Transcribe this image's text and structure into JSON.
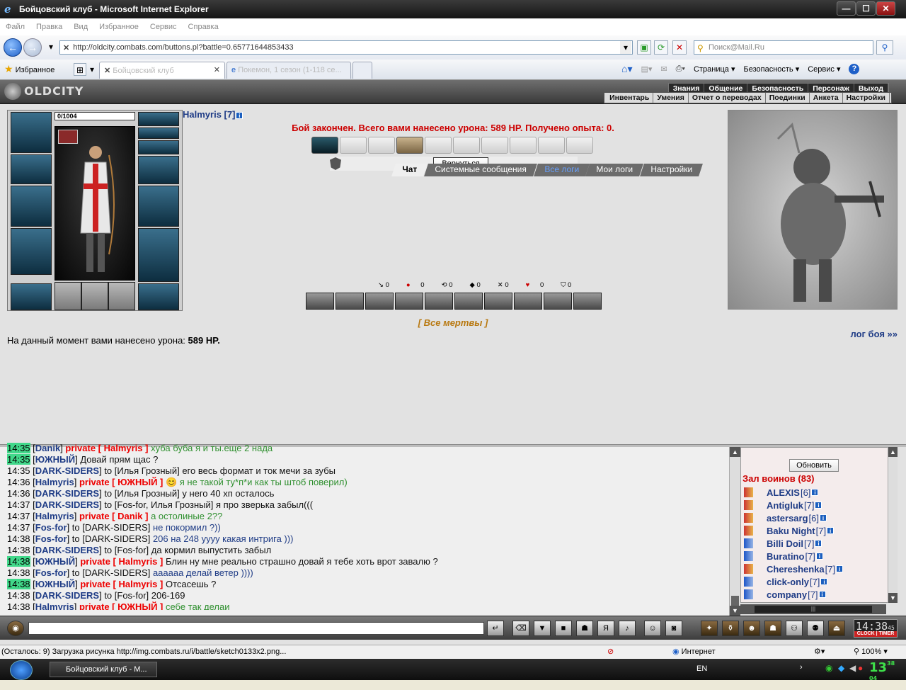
{
  "window": {
    "title": "Бойцовский клуб - Microsoft Internet Explorer",
    "minimize": "—",
    "maximize": "☐",
    "close": "✕"
  },
  "menu": [
    "Файл",
    "Правка",
    "Вид",
    "Избранное",
    "Сервис",
    "Справка"
  ],
  "address": {
    "url": "http://oldcity.combats.com/buttons.pl?battle=0.65771644853433",
    "search_placeholder": "Поиск@Mail.Ru"
  },
  "favorites": {
    "label": "Избранное",
    "tabs": [
      "Бойцовский клуб",
      "Покемон, 1 сезон (1-118 се..."
    ]
  },
  "command_bar": [
    "Страница ▾",
    "Безопасность ▾",
    "Сервис ▾"
  ],
  "game": {
    "logo": "OLDCITY",
    "top_nav": [
      "Знания",
      "Общение",
      "Безопасность",
      "Персонаж",
      "Выход"
    ],
    "sub_nav": [
      "Инвентарь",
      "Умения",
      "Отчет о переводах",
      "Поединки",
      "Анкета",
      "Настройки"
    ],
    "character": {
      "hp": "0/1004",
      "name": "Halmyris [7]",
      "info": "i"
    },
    "battle_message": "Бой закончен. Всего вами нанесено урона: 589 HP. Получено опыта: 0.",
    "return_button": "Вернуться",
    "stats": [
      "0",
      "0",
      "0",
      "0",
      "0",
      "0",
      "0"
    ],
    "all_dead": "[ Все мертвы ]",
    "damage_prefix": "На данный момент вами нанесено урона: ",
    "damage_value": "589 HP.",
    "battle_log": "лог боя »»"
  },
  "chat": {
    "tabs": [
      "Чат",
      "Системные сообщения",
      "Все логи",
      "Мои логи",
      "Настройки"
    ],
    "lines": [
      {
        "t": "14:35",
        "hl": true,
        "nick": "Danik",
        "private": "private [ Halmyris ]",
        "to": "",
        "msg": " хуба буба я и ты.еще 2 нада",
        "mc": "g"
      },
      {
        "t": "14:35",
        "hl": true,
        "nick": "ЮЖНЫЙ",
        "private": "",
        "to": "",
        "msg": " Довай прям щас ?",
        "mc": "k"
      },
      {
        "t": "14:35",
        "hl": false,
        "nick": "DARK-SIDERS",
        "private": "",
        "to": "to [Илья Грозный]",
        "msg": " его весь формат и ток мечи за зубы",
        "mc": "k"
      },
      {
        "t": "14:36",
        "hl": false,
        "nick": "Halmyris",
        "private": "private [ ЮЖНЫЙ ]",
        "to": "",
        "msg": " 😊 я не такой ту*п*и как ты штоб поверил)",
        "mc": "g"
      },
      {
        "t": "14:36",
        "hl": false,
        "nick": "DARK-SIDERS",
        "private": "",
        "to": "to [Илья Грозный]",
        "msg": " у него 40 хп осталось",
        "mc": "k"
      },
      {
        "t": "14:37",
        "hl": false,
        "nick": "DARK-SIDERS",
        "private": "",
        "to": "to [Fos-for, Илья Грозный]",
        "msg": " я про зверька забыл(((",
        "mc": "k"
      },
      {
        "t": "14:37",
        "hl": false,
        "nick": "Halmyris",
        "private": "private [ Danik ]",
        "to": "",
        "msg": " а остолиные 2??",
        "mc": "g"
      },
      {
        "t": "14:37",
        "hl": false,
        "nick": "Fos-for",
        "private": "",
        "to": "to [DARK-SIDERS]",
        "msg": " не покормил ?))",
        "mc": "b"
      },
      {
        "t": "14:38",
        "hl": false,
        "nick": "Fos-for",
        "private": "",
        "to": "to [DARK-SIDERS]",
        "msg": " 206 на 248 уууу какая интрига )))",
        "mc": "b"
      },
      {
        "t": "14:38",
        "hl": false,
        "nick": "DARK-SIDERS",
        "private": "",
        "to": "to [Fos-for]",
        "msg": " да кормил выпустить забыл",
        "mc": "k"
      },
      {
        "t": "14:38",
        "hl": true,
        "nick": "ЮЖНЫЙ",
        "private": "private [ Halmyris ]",
        "to": "",
        "msg": " Блин ну мне реально страшно довай я тебе хоть врот завалю ?",
        "mc": "k"
      },
      {
        "t": "14:38",
        "hl": false,
        "nick": "Fos-for",
        "private": "",
        "to": "to [DARK-SIDERS]",
        "msg": " аааааа делай ветер ))))",
        "mc": "b"
      },
      {
        "t": "14:38",
        "hl": true,
        "nick": "ЮЖНЫЙ",
        "private": "private [ Halmyris ]",
        "to": "",
        "msg": " Отсасешь ?",
        "mc": "k"
      },
      {
        "t": "14:38",
        "hl": false,
        "nick": "DARK-SIDERS",
        "private": "",
        "to": "to [Fos-for]",
        "msg": " 206-169",
        "mc": "k"
      },
      {
        "t": "14:38",
        "hl": false,
        "nick": "Halmyris",
        "private": "private [ ЮЖНЫЙ ]",
        "to": "",
        "msg": " себе так делаи",
        "mc": "g"
      }
    ]
  },
  "users": {
    "refresh": "Обновить",
    "hall_title": "Зал воинов (83)",
    "list": [
      {
        "n": "ALEXIS",
        "l": "[6]",
        "k": "a"
      },
      {
        "n": "Antigluk",
        "l": "[7]",
        "k": "a"
      },
      {
        "n": "astersarg",
        "l": "[6]",
        "k": "a"
      },
      {
        "n": "Baku Night",
        "l": "[7]",
        "k": "a"
      },
      {
        "n": "Billi Doil",
        "l": "[7]",
        "k": "b"
      },
      {
        "n": "Buratino",
        "l": "[7]",
        "k": "b"
      },
      {
        "n": "Chereshenka",
        "l": "[7]",
        "k": "a"
      },
      {
        "n": "click-only",
        "l": "[7]",
        "k": "b"
      },
      {
        "n": "company",
        "l": "[7]",
        "k": "b"
      }
    ]
  },
  "clock": {
    "time": "14:38",
    "sec": "45",
    "label": "CLOCK | TIMER"
  },
  "status": {
    "text": "(Осталось: 9) Загрузка рисунка http://img.combats.ru/i/battle/sketch0133x2.png...",
    "zone": "Интернет",
    "zoom": "100% ▾"
  },
  "taskbar": {
    "item": "Бойцовский клуб - M...",
    "lang": "EN",
    "time": "13",
    "time_small": "38",
    "time_sec": "04"
  }
}
